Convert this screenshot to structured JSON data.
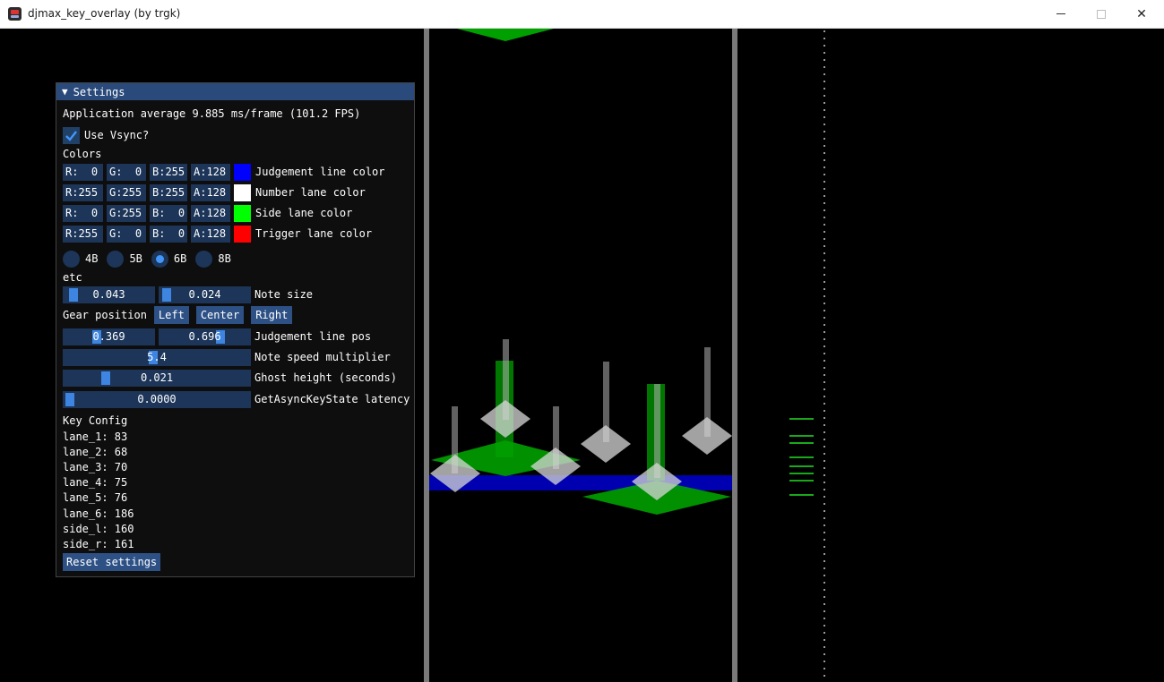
{
  "window": {
    "title": "djmax_key_overlay (by trgk)",
    "controls": {
      "minimize": "minimize",
      "maximize": "maximize",
      "close": "✕"
    }
  },
  "settings": {
    "header": "Settings",
    "fps_text": "Application average 9.885 ms/frame (101.2 FPS)",
    "vsync_label": "Use Vsync?",
    "vsync_checked": true,
    "colors_heading": "Colors",
    "colors": [
      {
        "r": "R:  0",
        "g": "G:  0",
        "b": "B:255",
        "a": "A:128",
        "swatch": "#0000ff",
        "label": "Judgement line color"
      },
      {
        "r": "R:255",
        "g": "G:255",
        "b": "B:255",
        "a": "A:128",
        "swatch": "#ffffff",
        "label": "Number lane color"
      },
      {
        "r": "R:  0",
        "g": "G:255",
        "b": "B:  0",
        "a": "A:128",
        "swatch": "#00ff00",
        "label": "Side lane color"
      },
      {
        "r": "R:255",
        "g": "G:  0",
        "b": "B:  0",
        "a": "A:128",
        "swatch": "#ff0000",
        "label": "Trigger lane color"
      }
    ],
    "modes": [
      "4B",
      "5B",
      "6B",
      "8B"
    ],
    "selected_mode": "6B",
    "etc_heading": "etc",
    "note_size": {
      "values": [
        "0.043",
        "0.024"
      ],
      "label": "Note size"
    },
    "gear_position": {
      "label": "Gear position",
      "buttons": [
        "Left",
        "Center",
        "Right"
      ]
    },
    "judgement_line_pos": {
      "values": [
        "0.369",
        "0.696"
      ],
      "label": "Judgement line pos"
    },
    "note_speed": {
      "value": "5.4",
      "label": "Note speed multiplier"
    },
    "ghost_height": {
      "value": "0.021",
      "label": "Ghost height (seconds)"
    },
    "latency": {
      "value": "0.0000",
      "label": "GetAsyncKeyState latency"
    },
    "key_config_heading": "Key Config",
    "keys": [
      "lane_1: 83",
      "lane_2: 68",
      "lane_3: 70",
      "lane_4: 75",
      "lane_5: 76",
      "lane_6: 186",
      "side_l: 160",
      "side_r: 161"
    ],
    "reset_label": "Reset settings"
  },
  "colors": {
    "accent": "#4296fa",
    "header": "#294a7a",
    "frame_bg": "#1c3558",
    "button": "#2d5085",
    "lane_divider": "#7a7a7a",
    "judgement_line": "#0000aa",
    "side_note": "#00aa00",
    "number_note": "#cfcfcf"
  }
}
